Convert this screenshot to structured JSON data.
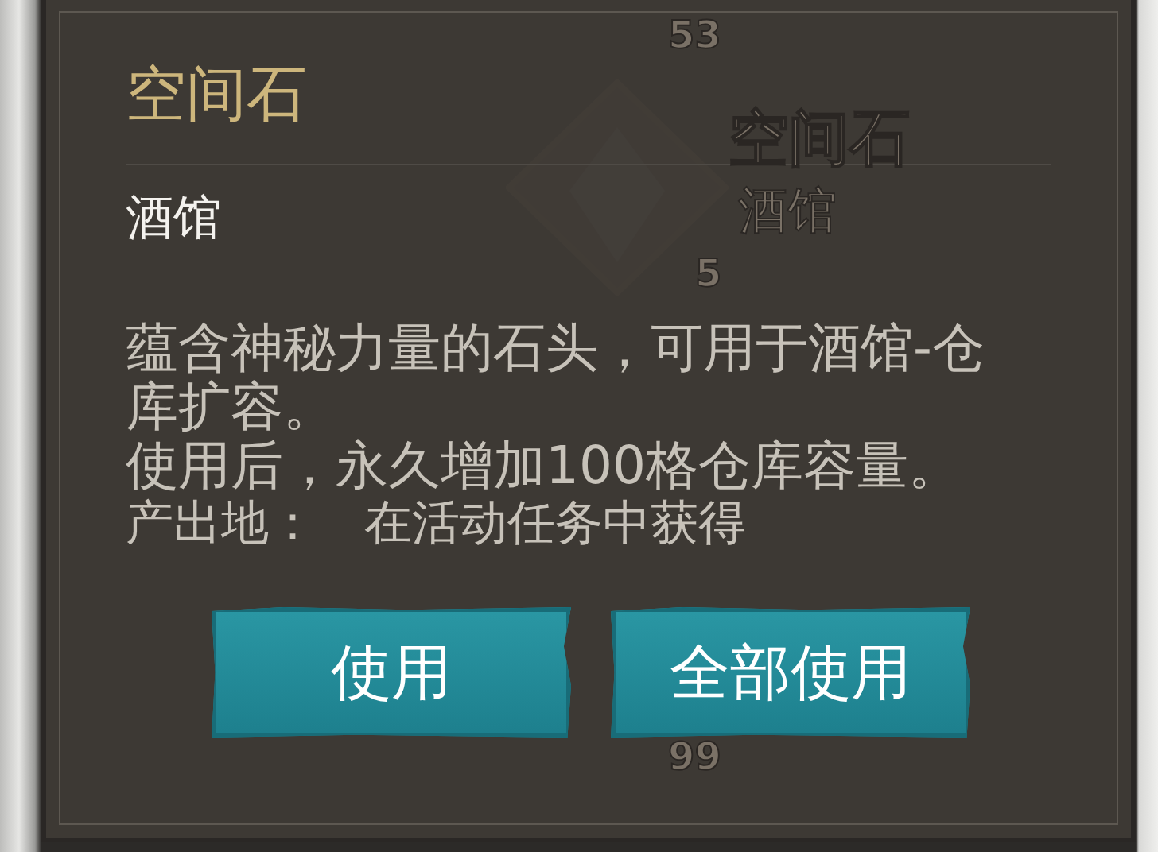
{
  "background_list": [
    {
      "kind": "count",
      "text": "53"
    },
    {
      "kind": "name",
      "text": "空间石"
    },
    {
      "kind": "location",
      "text": "酒馆"
    },
    {
      "kind": "count",
      "text": "5"
    },
    {
      "kind": "count",
      "text": "99"
    }
  ],
  "dialog": {
    "title": "空间石",
    "location": "酒馆",
    "description": [
      "蕴含神秘力量的石头，可用于酒馆-仓库扩容。",
      "使用后，永久增加100格仓库容量。"
    ],
    "source_label": "产出地：",
    "source_value": "在活动任务中获得",
    "buttons": [
      "使用",
      "全部使用"
    ]
  }
}
